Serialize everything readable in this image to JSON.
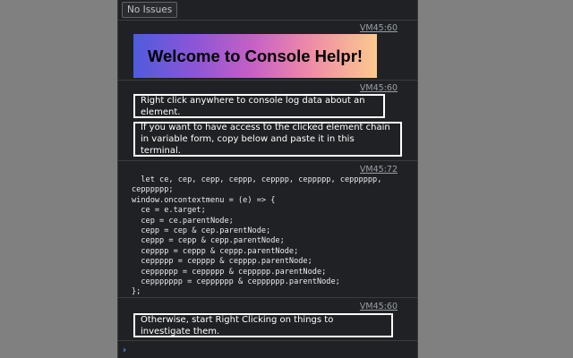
{
  "toolbar": {
    "issues_label": "No Issues"
  },
  "messages": [
    {
      "source": "VM45:60",
      "banner": "Welcome to Console Helpr!"
    },
    {
      "source": "VM45:60",
      "line1": "Right click anywhere to console log data about an element.",
      "line2": "If you want to have access to the clicked element chain in variable form, copy below and paste it in this terminal."
    },
    {
      "source": "VM45:72",
      "code": "  let ce, cep, cepp, ceppp, cepppp, ceppppp, cepppppp,\ncepppppp;\nwindow.oncontextmenu = (e) => {\n  ce = e.target;\n  cep = ce.parentNode;\n  cepp = cep & cep.parentNode;\n  ceppp = cepp & cepp.parentNode;\n  cepppp = ceppp & ceppp.parentNode;\n  ceppppp = cepppp & cepppp.parentNode;\n  cepppppp = ceppppp & ceppppp.parentNode;\n  ceppppppp = cepppppp & cepppppp.parentNode;\n};"
    },
    {
      "source": "VM45:60",
      "line1": "Otherwise, start Right Clicking on things to investigate them."
    }
  ],
  "prompt": {
    "icon": "chevron-right-icon",
    "glyph": "›"
  },
  "colors": {
    "console_bg": "#202124",
    "page_bg": "#808080",
    "link": "#9aa0a6",
    "prompt": "#4d90fe"
  }
}
